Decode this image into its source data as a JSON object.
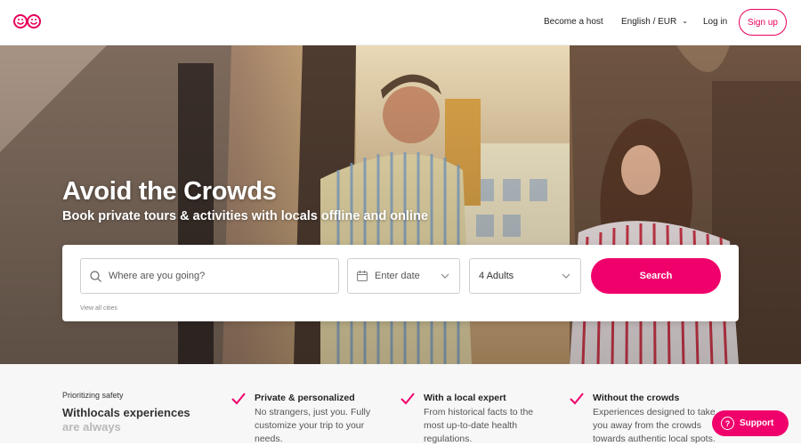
{
  "nav": {
    "logo": "logo-icon",
    "become_host": "Become a host",
    "language": "English / EUR",
    "login": "Log in",
    "signup": "Sign up"
  },
  "hero": {
    "title": "Avoid the Crowds",
    "subtitle": "Book private tours & activities with locals offline and online"
  },
  "search": {
    "where_placeholder": "Where are you going?",
    "date_placeholder": "Enter date",
    "guests_value": "4 Adults",
    "button": "Search",
    "view_all": "View all cities"
  },
  "safety": {
    "kicker": "Prioritizing safety",
    "title_line1": "Withlocals experiences",
    "title_line2": "are always"
  },
  "features": [
    {
      "title": "Private & personalized",
      "desc": "No strangers, just you. Fully customize your trip to your needs."
    },
    {
      "title": "With a local expert",
      "desc": "From historical facts to the most up-to-date health regulations."
    },
    {
      "title": "Without the crowds",
      "desc": "Experiences designed to take you away from the crowds towards authentic local spots."
    }
  ],
  "support": {
    "label": "Support"
  },
  "colors": {
    "accent": "#f0006b"
  }
}
